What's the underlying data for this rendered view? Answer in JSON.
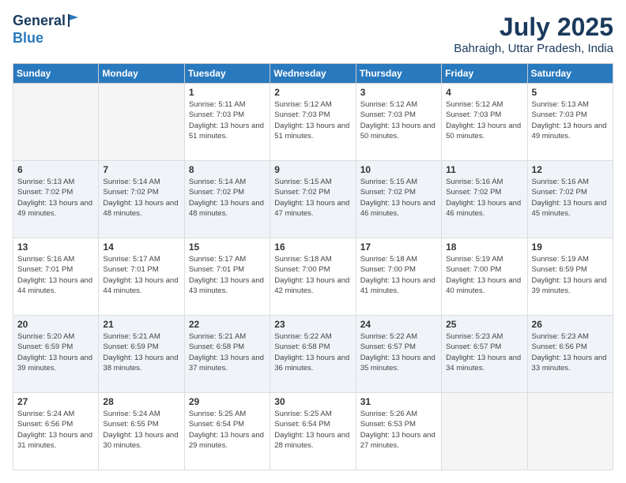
{
  "header": {
    "logo_line1": "General",
    "logo_line2": "Blue",
    "month_year": "July 2025",
    "location": "Bahraigh, Uttar Pradesh, India"
  },
  "weekdays": [
    "Sunday",
    "Monday",
    "Tuesday",
    "Wednesday",
    "Thursday",
    "Friday",
    "Saturday"
  ],
  "weeks": [
    [
      {
        "day": "",
        "empty": true
      },
      {
        "day": "",
        "empty": true
      },
      {
        "day": "1",
        "sunrise": "5:11 AM",
        "sunset": "7:03 PM",
        "daylight": "13 hours and 51 minutes."
      },
      {
        "day": "2",
        "sunrise": "5:12 AM",
        "sunset": "7:03 PM",
        "daylight": "13 hours and 51 minutes."
      },
      {
        "day": "3",
        "sunrise": "5:12 AM",
        "sunset": "7:03 PM",
        "daylight": "13 hours and 50 minutes."
      },
      {
        "day": "4",
        "sunrise": "5:12 AM",
        "sunset": "7:03 PM",
        "daylight": "13 hours and 50 minutes."
      },
      {
        "day": "5",
        "sunrise": "5:13 AM",
        "sunset": "7:03 PM",
        "daylight": "13 hours and 49 minutes."
      }
    ],
    [
      {
        "day": "6",
        "sunrise": "5:13 AM",
        "sunset": "7:02 PM",
        "daylight": "13 hours and 49 minutes."
      },
      {
        "day": "7",
        "sunrise": "5:14 AM",
        "sunset": "7:02 PM",
        "daylight": "13 hours and 48 minutes."
      },
      {
        "day": "8",
        "sunrise": "5:14 AM",
        "sunset": "7:02 PM",
        "daylight": "13 hours and 48 minutes."
      },
      {
        "day": "9",
        "sunrise": "5:15 AM",
        "sunset": "7:02 PM",
        "daylight": "13 hours and 47 minutes."
      },
      {
        "day": "10",
        "sunrise": "5:15 AM",
        "sunset": "7:02 PM",
        "daylight": "13 hours and 46 minutes."
      },
      {
        "day": "11",
        "sunrise": "5:16 AM",
        "sunset": "7:02 PM",
        "daylight": "13 hours and 46 minutes."
      },
      {
        "day": "12",
        "sunrise": "5:16 AM",
        "sunset": "7:02 PM",
        "daylight": "13 hours and 45 minutes."
      }
    ],
    [
      {
        "day": "13",
        "sunrise": "5:16 AM",
        "sunset": "7:01 PM",
        "daylight": "13 hours and 44 minutes."
      },
      {
        "day": "14",
        "sunrise": "5:17 AM",
        "sunset": "7:01 PM",
        "daylight": "13 hours and 44 minutes."
      },
      {
        "day": "15",
        "sunrise": "5:17 AM",
        "sunset": "7:01 PM",
        "daylight": "13 hours and 43 minutes."
      },
      {
        "day": "16",
        "sunrise": "5:18 AM",
        "sunset": "7:00 PM",
        "daylight": "13 hours and 42 minutes."
      },
      {
        "day": "17",
        "sunrise": "5:18 AM",
        "sunset": "7:00 PM",
        "daylight": "13 hours and 41 minutes."
      },
      {
        "day": "18",
        "sunrise": "5:19 AM",
        "sunset": "7:00 PM",
        "daylight": "13 hours and 40 minutes."
      },
      {
        "day": "19",
        "sunrise": "5:19 AM",
        "sunset": "6:59 PM",
        "daylight": "13 hours and 39 minutes."
      }
    ],
    [
      {
        "day": "20",
        "sunrise": "5:20 AM",
        "sunset": "6:59 PM",
        "daylight": "13 hours and 39 minutes."
      },
      {
        "day": "21",
        "sunrise": "5:21 AM",
        "sunset": "6:59 PM",
        "daylight": "13 hours and 38 minutes."
      },
      {
        "day": "22",
        "sunrise": "5:21 AM",
        "sunset": "6:58 PM",
        "daylight": "13 hours and 37 minutes."
      },
      {
        "day": "23",
        "sunrise": "5:22 AM",
        "sunset": "6:58 PM",
        "daylight": "13 hours and 36 minutes."
      },
      {
        "day": "24",
        "sunrise": "5:22 AM",
        "sunset": "6:57 PM",
        "daylight": "13 hours and 35 minutes."
      },
      {
        "day": "25",
        "sunrise": "5:23 AM",
        "sunset": "6:57 PM",
        "daylight": "13 hours and 34 minutes."
      },
      {
        "day": "26",
        "sunrise": "5:23 AM",
        "sunset": "6:56 PM",
        "daylight": "13 hours and 33 minutes."
      }
    ],
    [
      {
        "day": "27",
        "sunrise": "5:24 AM",
        "sunset": "6:56 PM",
        "daylight": "13 hours and 31 minutes."
      },
      {
        "day": "28",
        "sunrise": "5:24 AM",
        "sunset": "6:55 PM",
        "daylight": "13 hours and 30 minutes."
      },
      {
        "day": "29",
        "sunrise": "5:25 AM",
        "sunset": "6:54 PM",
        "daylight": "13 hours and 29 minutes."
      },
      {
        "day": "30",
        "sunrise": "5:25 AM",
        "sunset": "6:54 PM",
        "daylight": "13 hours and 28 minutes."
      },
      {
        "day": "31",
        "sunrise": "5:26 AM",
        "sunset": "6:53 PM",
        "daylight": "13 hours and 27 minutes."
      },
      {
        "day": "",
        "empty": true
      },
      {
        "day": "",
        "empty": true
      }
    ]
  ],
  "labels": {
    "sunrise_prefix": "Sunrise: ",
    "sunset_prefix": "Sunset: ",
    "daylight_prefix": "Daylight: "
  }
}
